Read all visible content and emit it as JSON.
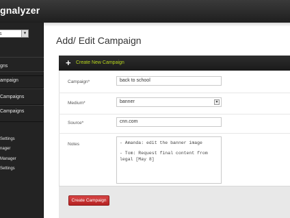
{
  "app": {
    "brand": "gnalyzer"
  },
  "sidebar": {
    "select_value": "s",
    "items": [
      {
        "label": "gns"
      },
      {
        "label": "ampaign"
      },
      {
        "label": "Campaigns"
      },
      {
        "label": "Campaigns"
      }
    ],
    "sub_items": [
      {
        "label": "Settings"
      },
      {
        "label": "nager"
      },
      {
        "label": "Manager"
      },
      {
        "label": "Settings"
      }
    ]
  },
  "page": {
    "title": "Add/ Edit Campaign"
  },
  "panel": {
    "header": "Create New Campaign"
  },
  "form": {
    "campaign_label": "Campaign*",
    "campaign_value": "back to school",
    "medium_label": "Medium*",
    "medium_value": "banner",
    "source_label": "Source*",
    "source_value": "cnn.com",
    "notes_label": "Notes",
    "notes_line1": "- Amanda: edit the banner image",
    "notes_line2": "- Tom: Request final content from legal [May 8]"
  },
  "actions": {
    "create_label": "Create Campaign"
  },
  "colors": {
    "accent": "#b7d51c",
    "button": "#c0302f",
    "header_bg": "#222222"
  }
}
